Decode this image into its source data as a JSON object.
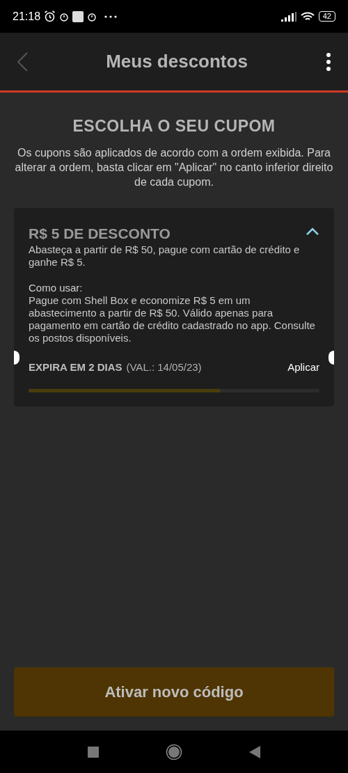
{
  "status_bar": {
    "time": "21:18",
    "battery": "42"
  },
  "app_bar": {
    "title": "Meus descontos"
  },
  "heading": "ESCOLHA O SEU CUPOM",
  "intro": "Os cupons são aplicados de acordo com a ordem exibida. Para alterar a ordem, basta clicar em \"Aplicar\" no canto inferior direito de cada cupom.",
  "coupons": [
    {
      "title": "R$ 5 DE DESCONTO",
      "expanded": true,
      "summary": "Abasteça a partir de R$ 50, pague com cartão de crédito e ganhe R$ 5.",
      "how_to_label": "Como usar:",
      "how_to": "Pague com Shell Box e economize R$ 5 em um abastecimento a partir de R$ 50. Válido apenas para pagamento em cartão de crédito cadastrado no app. Consulte os postos disponíveis.",
      "expiry": "EXPIRA EM 2 DIAS",
      "validity": "(VAL.: 14/05/23)",
      "action": "Aplicar",
      "level": 0.66
    }
  ],
  "primary_button": "Ativar novo código"
}
